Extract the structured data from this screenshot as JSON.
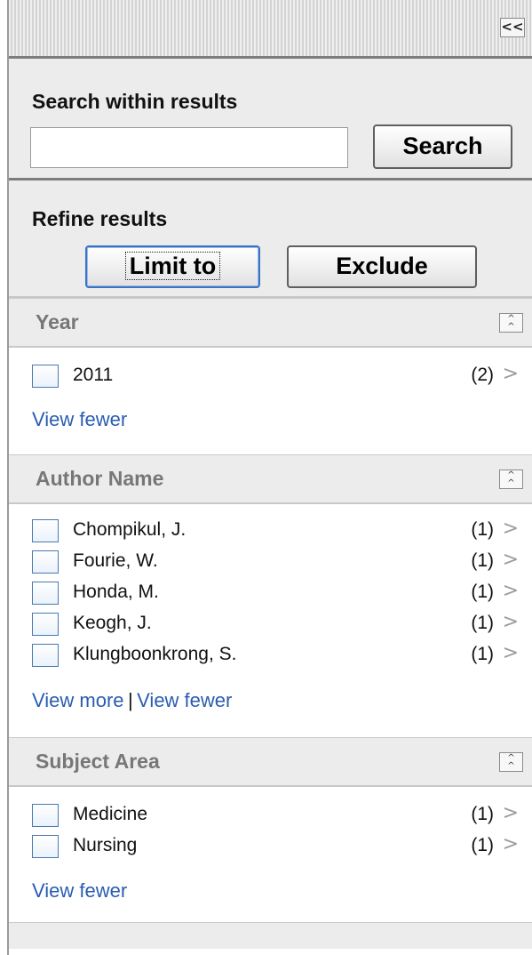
{
  "panel": {
    "collapse_label": "<<"
  },
  "search": {
    "title": "Search within results",
    "input_value": "",
    "button_label": "Search"
  },
  "refine": {
    "title": "Refine results",
    "limit_label": "Limit to",
    "exclude_label": "Exclude"
  },
  "facets": {
    "year": {
      "title": "Year",
      "items": [
        {
          "label": "2011",
          "count": "(2)"
        }
      ],
      "view_fewer": "View fewer"
    },
    "author": {
      "title": "Author Name",
      "items": [
        {
          "label": "Chompikul, J.",
          "count": "(1)"
        },
        {
          "label": "Fourie, W.",
          "count": "(1)"
        },
        {
          "label": "Honda, M.",
          "count": "(1)"
        },
        {
          "label": "Keogh, J.",
          "count": "(1)"
        },
        {
          "label": "Klungboonkrong, S.",
          "count": "(1)"
        }
      ],
      "view_more": "View more",
      "separator": "|",
      "view_fewer": "View fewer"
    },
    "subject": {
      "title": "Subject Area",
      "items": [
        {
          "label": "Medicine",
          "count": "(1)"
        },
        {
          "label": "Nursing",
          "count": "(1)"
        }
      ],
      "view_fewer": "View fewer"
    }
  },
  "icons": {
    "collapse_panel": "double-chevron-left-icon",
    "collapse_facet": "double-chevron-up-icon",
    "row_arrow": "chevron-right-icon"
  },
  "colors": {
    "link": "#2a5db0",
    "header_bg": "#ececec",
    "checkbox_border": "#4a7ab0"
  }
}
